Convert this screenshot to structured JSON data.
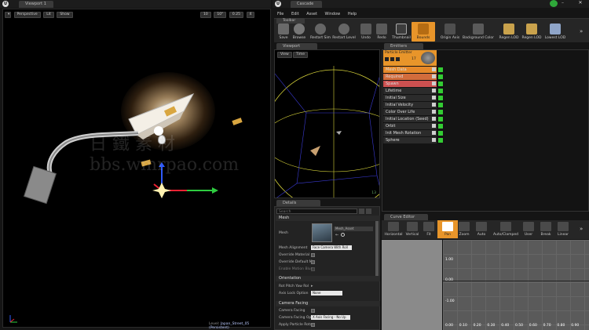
{
  "viewport_left": {
    "tab_label": "Viewport 1",
    "perspective_label": "Perspective",
    "lit_label": "Lit",
    "show_label": "Show",
    "snap_value": "10",
    "angle_value": "10°",
    "scale_value": "0.25",
    "cam_speed": "4",
    "level_label": "Level:",
    "level_name": "Japan_Street_05 (Persistent)"
  },
  "cascade": {
    "tab_label": "Cascade",
    "menu": [
      "File",
      "Edit",
      "Asset",
      "Window",
      "Help"
    ],
    "toolbar_tab": "Toolbar",
    "toolbar": [
      "Save",
      "Browse",
      "Restart Sim",
      "Restart Level",
      "Undo",
      "Redo",
      "Thumbnail",
      "Bounds",
      "Origin Axis",
      "Background Color",
      "Regen LOD",
      "Regen LOD",
      "Lowest LOD"
    ],
    "viewport_tab": "Viewport",
    "view_label": "View",
    "time_label": "Time",
    "viewport_counter": "13",
    "emitters_tab": "Emitters",
    "emitter_name": "Particle Emitter",
    "emitter_count": "17",
    "modules": [
      {
        "label": "Mesh Data",
        "color": "#e6892a"
      },
      {
        "label": "Required",
        "color": "#d26c3c"
      },
      {
        "label": "Spawn",
        "color": "#cc5050"
      },
      {
        "label": "Lifetime",
        "color": "#2b2b2b"
      },
      {
        "label": "Initial Size",
        "color": "#2b2b2b"
      },
      {
        "label": "Initial Velocity",
        "color": "#2b2b2b"
      },
      {
        "label": "Color Over Life",
        "color": "#2b2b2b"
      },
      {
        "label": "Initial Location (Seed)",
        "color": "#2b2b2b"
      },
      {
        "label": "Orbit",
        "color": "#2b2b2b"
      },
      {
        "label": "Init Mesh Rotation",
        "color": "#2b2b2b"
      },
      {
        "label": "Sphere",
        "color": "#2b2b2b"
      }
    ],
    "details_tab": "Details",
    "search_placeholder": "Search",
    "section_mesh": "Mesh",
    "mesh_label": "Mesh",
    "mesh_asset": "Mesh_Asset",
    "mesh_alignment_label": "Mesh Alignment",
    "mesh_alignment_value": "Face Camera With Roll",
    "override_material": "Override Material",
    "override_default": "Override Default M",
    "enable_motion_blur": "Enable Motion Blur",
    "section_orientation": "Orientation",
    "rot_pitch_label": "Rot Pitch Yaw Rol",
    "axis_lock_label": "Axis Lock Option",
    "axis_lock_value": "None",
    "section_camera": "Camera Facing",
    "camera_facing": "Camera Facing",
    "camera_facing_opt": "Camera Facing Op",
    "camera_facing_value": "X Axis Facing - No Up",
    "apply_particle_rot": "Apply Particle Rota",
    "curve_tab": "Curve Editor",
    "curve_tools": [
      "Horizontal",
      "Vertical",
      "Fit",
      "Pan",
      "Zoom",
      "Auto",
      "Auto/Clamped",
      "User",
      "Break",
      "Linear"
    ],
    "y_labels": [
      "1.00",
      "0.00",
      "-1.00"
    ],
    "x_labels": [
      "0.00",
      "0.10",
      "0.20",
      "0.30",
      "0.40",
      "0.50",
      "0.60",
      "0.70",
      "0.80",
      "0.90"
    ]
  },
  "colors": {
    "accent": "#e8952a",
    "panel": "#2b2b2b",
    "bg": "#151515"
  },
  "watermark": "日 鐵 素 材 bbs.wmrpao.com"
}
